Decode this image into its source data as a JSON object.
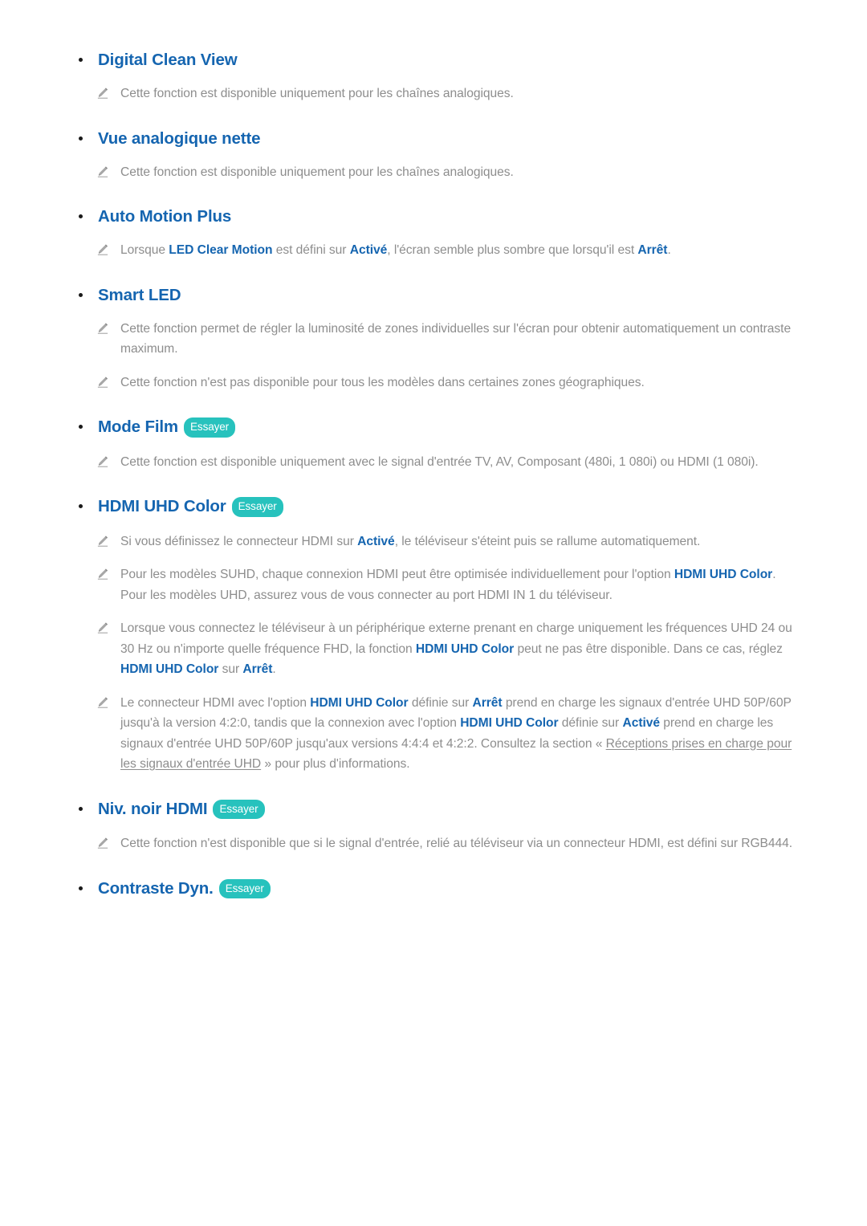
{
  "document": {
    "language": "fr",
    "colors": {
      "heading_blue": "#1565b0",
      "body_gray": "#8d8d8d",
      "badge_teal": "#27c2bd",
      "bullet_black": "#1a1a1a",
      "background": "#ffffff"
    },
    "badge_label": "Essayer",
    "pencil_icon_name": "pencil-icon"
  },
  "sections": [
    {
      "id": "digital-clean-view",
      "title": "Digital Clean View",
      "has_badge": false,
      "notes": [
        {
          "parts": [
            {
              "t": "Cette fonction est disponible uniquement pour les chaînes analogiques.",
              "s": "n"
            }
          ]
        }
      ]
    },
    {
      "id": "vue-analogique-nette",
      "title": "Vue analogique nette",
      "has_badge": false,
      "notes": [
        {
          "parts": [
            {
              "t": "Cette fonction est disponible uniquement pour les chaînes analogiques.",
              "s": "n"
            }
          ]
        }
      ]
    },
    {
      "id": "auto-motion-plus",
      "title": "Auto Motion Plus",
      "has_badge": false,
      "notes": [
        {
          "parts": [
            {
              "t": "Lorsque ",
              "s": "n"
            },
            {
              "t": "LED Clear Motion",
              "s": "b"
            },
            {
              "t": " est défini sur ",
              "s": "n"
            },
            {
              "t": "Activé",
              "s": "b"
            },
            {
              "t": ", l'écran semble plus sombre que lorsqu'il est ",
              "s": "n"
            },
            {
              "t": "Arrêt",
              "s": "b"
            },
            {
              "t": ".",
              "s": "n"
            }
          ]
        }
      ]
    },
    {
      "id": "smart-led",
      "title": "Smart LED",
      "has_badge": false,
      "notes": [
        {
          "parts": [
            {
              "t": "Cette fonction permet de régler la luminosité de zones individuelles sur l'écran pour obtenir automatiquement un contraste maximum.",
              "s": "n"
            }
          ]
        },
        {
          "parts": [
            {
              "t": "Cette fonction n'est pas disponible pour tous les modèles dans certaines zones géographiques.",
              "s": "n"
            }
          ]
        }
      ]
    },
    {
      "id": "mode-film",
      "title": "Mode Film",
      "has_badge": true,
      "notes": [
        {
          "parts": [
            {
              "t": "Cette fonction est disponible uniquement avec le signal d'entrée TV, AV, Composant (480i, 1 080i) ou HDMI (1 080i).",
              "s": "n"
            }
          ]
        }
      ]
    },
    {
      "id": "hdmi-uhd-color",
      "title": "HDMI UHD Color",
      "has_badge": true,
      "notes": [
        {
          "parts": [
            {
              "t": "Si vous définissez le connecteur HDMI sur ",
              "s": "n"
            },
            {
              "t": "Activé",
              "s": "b"
            },
            {
              "t": ", le téléviseur s'éteint puis se rallume automatiquement.",
              "s": "n"
            }
          ]
        },
        {
          "parts": [
            {
              "t": "Pour les modèles SUHD, chaque connexion HDMI peut être optimisée individuellement pour l'option ",
              "s": "n"
            },
            {
              "t": "HDMI UHD Color",
              "s": "b"
            },
            {
              "t": ". Pour les modèles UHD, assurez vous de vous connecter au port HDMI IN 1 du téléviseur.",
              "s": "n"
            }
          ]
        },
        {
          "parts": [
            {
              "t": "Lorsque vous connectez le téléviseur à un périphérique externe prenant en charge uniquement les fréquences UHD 24 ou 30 Hz ou n'importe quelle fréquence FHD, la fonction ",
              "s": "n"
            },
            {
              "t": "HDMI UHD Color",
              "s": "b"
            },
            {
              "t": " peut ne pas être disponible. Dans ce cas, réglez ",
              "s": "n"
            },
            {
              "t": "HDMI UHD Color",
              "s": "b"
            },
            {
              "t": " sur ",
              "s": "n"
            },
            {
              "t": "Arrêt",
              "s": "b"
            },
            {
              "t": ".",
              "s": "n"
            }
          ]
        },
        {
          "parts": [
            {
              "t": "Le connecteur HDMI avec l'option ",
              "s": "n"
            },
            {
              "t": "HDMI UHD Color",
              "s": "b"
            },
            {
              "t": " définie sur ",
              "s": "n"
            },
            {
              "t": "Arrêt",
              "s": "b"
            },
            {
              "t": " prend en charge les signaux d'entrée UHD 50P/60P jusqu'à la version 4:2:0, tandis que la connexion avec l'option ",
              "s": "n"
            },
            {
              "t": "HDMI UHD Color",
              "s": "b"
            },
            {
              "t": " définie sur ",
              "s": "n"
            },
            {
              "t": "Activé",
              "s": "b"
            },
            {
              "t": " prend en charge les signaux d'entrée UHD 50P/60P jusqu'aux versions 4:4:4 et 4:2:2. Consultez la section « ",
              "s": "n"
            },
            {
              "t": "Réceptions prises en charge pour les signaux d'entrée UHD",
              "s": "l"
            },
            {
              "t": " » pour plus d'informations.",
              "s": "n"
            }
          ]
        }
      ]
    },
    {
      "id": "niv-noir-hdmi",
      "title": "Niv. noir HDMI",
      "has_badge": true,
      "notes": [
        {
          "parts": [
            {
              "t": "Cette fonction n'est disponible que si le signal d'entrée, relié au téléviseur via un connecteur HDMI, est défini sur RGB444.",
              "s": "n"
            }
          ]
        }
      ]
    },
    {
      "id": "contraste-dyn",
      "title": "Contraste Dyn.",
      "has_badge": true,
      "notes": []
    }
  ]
}
